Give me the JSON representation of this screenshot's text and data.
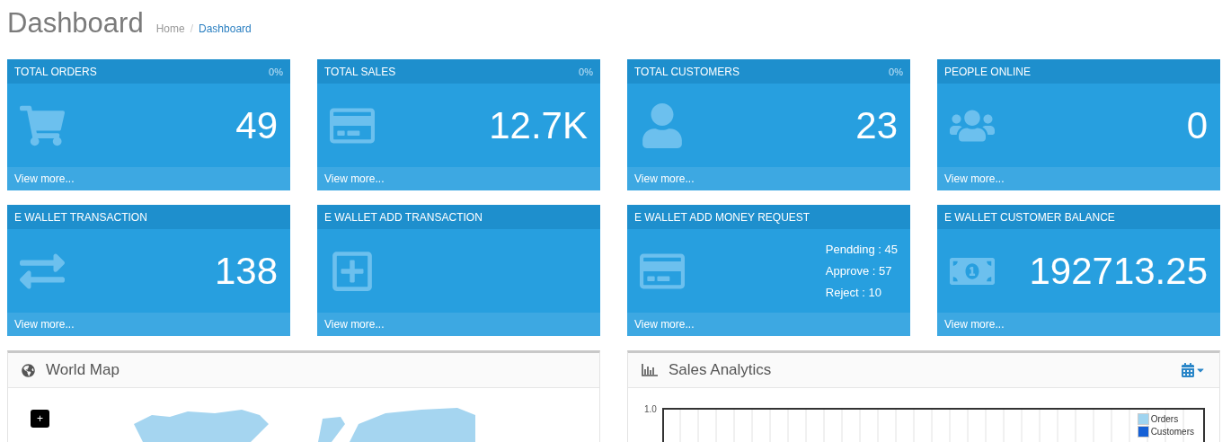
{
  "page": {
    "title": "Dashboard",
    "breadcrumb_separator": "/",
    "breadcrumb": [
      {
        "label": "Home",
        "selected": false
      },
      {
        "label": "Dashboard",
        "selected": true
      }
    ]
  },
  "cards": [
    {
      "kind": "value",
      "title": "TOTAL ORDERS",
      "percent": "0%",
      "value": "49",
      "link": "View more..."
    },
    {
      "kind": "value",
      "title": "TOTAL SALES",
      "percent": "0%",
      "value": "12.7K",
      "link": "View more..."
    },
    {
      "kind": "value",
      "title": "TOTAL CUSTOMERS",
      "percent": "0%",
      "value": "23",
      "link": "View more..."
    },
    {
      "kind": "value",
      "title": "PEOPLE ONLINE",
      "value": "0",
      "link": "View more..."
    },
    {
      "kind": "value",
      "title": "E WALLET TRANSACTION",
      "value": "138",
      "link": "View more..."
    },
    {
      "kind": "empty",
      "title": "E WALLET ADD TRANSACTION",
      "link": "View more..."
    },
    {
      "kind": "breakdown",
      "title": "E WALLET ADD MONEY REQUEST",
      "lines": [
        "Pendding : 45",
        "Approve : 57",
        "Reject : 10"
      ],
      "link": "View more..."
    },
    {
      "kind": "value",
      "title": "E WALLET CUSTOMER BALANCE",
      "value": "192713.25",
      "link": "View more..."
    }
  ],
  "world_map": {
    "title": "World Map",
    "zoom_button": "+"
  },
  "sales_analytics": {
    "title": "Sales Analytics",
    "y_tick": "1.0",
    "legend": [
      {
        "label": "Orders",
        "color": "#9fd4f0"
      },
      {
        "label": "Customers",
        "color": "#1560d6"
      }
    ]
  }
}
